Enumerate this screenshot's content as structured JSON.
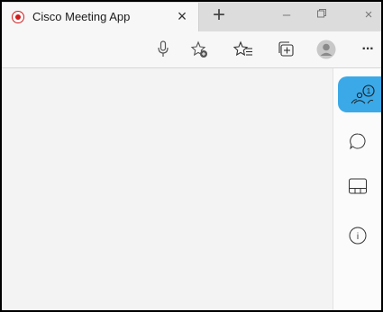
{
  "browser": {
    "tab": {
      "title": "Cisco Meeting App",
      "favicon": "cisco-record-icon",
      "close_symbol": "×"
    },
    "new_tab_symbol": "+",
    "window_controls": {
      "minimize": "–",
      "restore": "restore-icon",
      "close": "×"
    },
    "toolbar": {
      "more_label": "···",
      "icons": [
        "microphone-icon",
        "add-favorite-icon",
        "favorites-icon",
        "collections-icon",
        "profile-icon"
      ]
    }
  },
  "side_panel": {
    "items": [
      {
        "name": "participants-icon",
        "active": true,
        "badge": "1"
      },
      {
        "name": "chat-icon",
        "active": false
      },
      {
        "name": "layout-icon",
        "active": false
      },
      {
        "name": "info-icon",
        "active": false,
        "glyph": "i"
      }
    ],
    "active_color": "#3ba9e8"
  }
}
